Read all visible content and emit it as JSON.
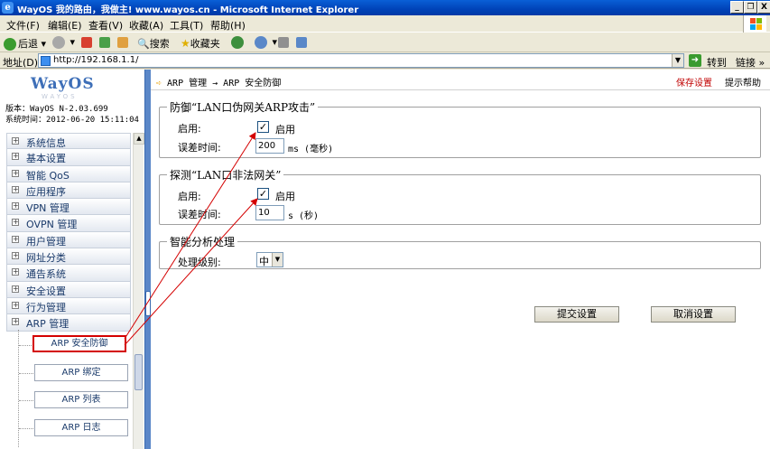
{
  "window": {
    "title": "WayOS 我的路由，我做主! www.wayos.cn - Microsoft Internet Explorer",
    "buttons": [
      "_",
      "❐",
      "X"
    ]
  },
  "menubar": [
    "文件(F)",
    "编辑(E)",
    "查看(V)",
    "收藏(A)",
    "工具(T)",
    "帮助(H)"
  ],
  "toolbar": {
    "back": "后退",
    "search": "搜索",
    "favorites": "收藏夹"
  },
  "addressbar": {
    "label": "地址(D)",
    "url": "http://192.168.1.1/",
    "go": "转到",
    "links": "链接 »"
  },
  "sidebar": {
    "logo": "WayOS",
    "logo_sub": "WAYOS",
    "version": "版本：WayOS N-2.03.699",
    "systime": "系统时间：2012-06-20 15:11:04",
    "items": [
      {
        "label": "系统信息"
      },
      {
        "label": "基本设置"
      },
      {
        "label": "智能 QoS"
      },
      {
        "label": "应用程序"
      },
      {
        "label": "VPN 管理"
      },
      {
        "label": "OVPN 管理"
      },
      {
        "label": "用户管理"
      },
      {
        "label": "网址分类"
      },
      {
        "label": "通告系统"
      },
      {
        "label": "安全设置"
      },
      {
        "label": "行为管理"
      },
      {
        "label": "ARP 管理"
      }
    ],
    "subitems": [
      {
        "label": "ARP 安全防御"
      },
      {
        "label": "ARP 绑定"
      },
      {
        "label": "ARP 列表"
      },
      {
        "label": "ARP 日志"
      }
    ]
  },
  "main": {
    "breadcrumb": "ARP 管理 → ARP 安全防御",
    "save_link": "保存设置",
    "help_link": "提示帮助",
    "group1": {
      "legend": "防御“LAN口伪网关ARP攻击”",
      "enable_label": "启用:",
      "enable_check": "启用",
      "error_label": "误差时间:",
      "error_value": "200",
      "error_unit": "ms (毫秒)"
    },
    "group2": {
      "legend": "探测“LAN口非法网关”",
      "enable_label": "启用:",
      "enable_check": "启用",
      "error_label": "误差时间:",
      "error_value": "10",
      "error_unit": "s (秒)"
    },
    "group3": {
      "legend": "智能分析处理",
      "level_label": "处理级别:",
      "level_value": "中"
    },
    "submit": "提交设置",
    "cancel": "取消设置"
  },
  "colors": {
    "annotation": "#d40000",
    "titlebar": "#0043b8",
    "divider": "#5b87c8"
  }
}
